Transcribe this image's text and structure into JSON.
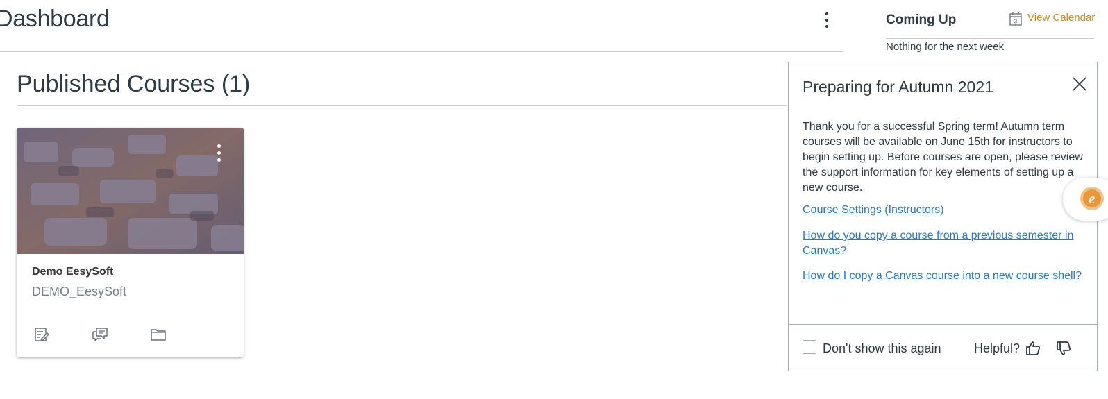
{
  "header": {
    "title": "Dashboard"
  },
  "section": {
    "title": "Published Courses (1)"
  },
  "course_card": {
    "name": "Demo EesySoft",
    "code": "DEMO_EesySoft",
    "actions": [
      {
        "icon": "assignments-icon"
      },
      {
        "icon": "discussions-icon"
      },
      {
        "icon": "files-icon"
      }
    ]
  },
  "sidebar": {
    "coming_up_title": "Coming Up",
    "view_calendar_label": "View Calendar",
    "calendar_day": "3",
    "empty_text": "Nothing for the next week",
    "accent_color": "#d08a1e"
  },
  "popup": {
    "title": "Preparing for Autumn 2021",
    "body": "Thank you for a successful Spring term! Autumn term courses will be available on June 15th for instructors to begin setting up. Before courses are open, please review the support information for key elements of setting up a new course.",
    "links": [
      "Course Settings (Instructors)",
      "How do you copy a course from a previous semester in Canvas?",
      "How do I copy a Canvas course into a new course shell?"
    ],
    "dont_show_label": "Don't show this again",
    "dont_show_checked": false,
    "helpful_label": "Helpful?",
    "link_color": "#2b7abc"
  },
  "assistant": {
    "icon": "eesy-assistant-icon",
    "glyph": "e"
  }
}
